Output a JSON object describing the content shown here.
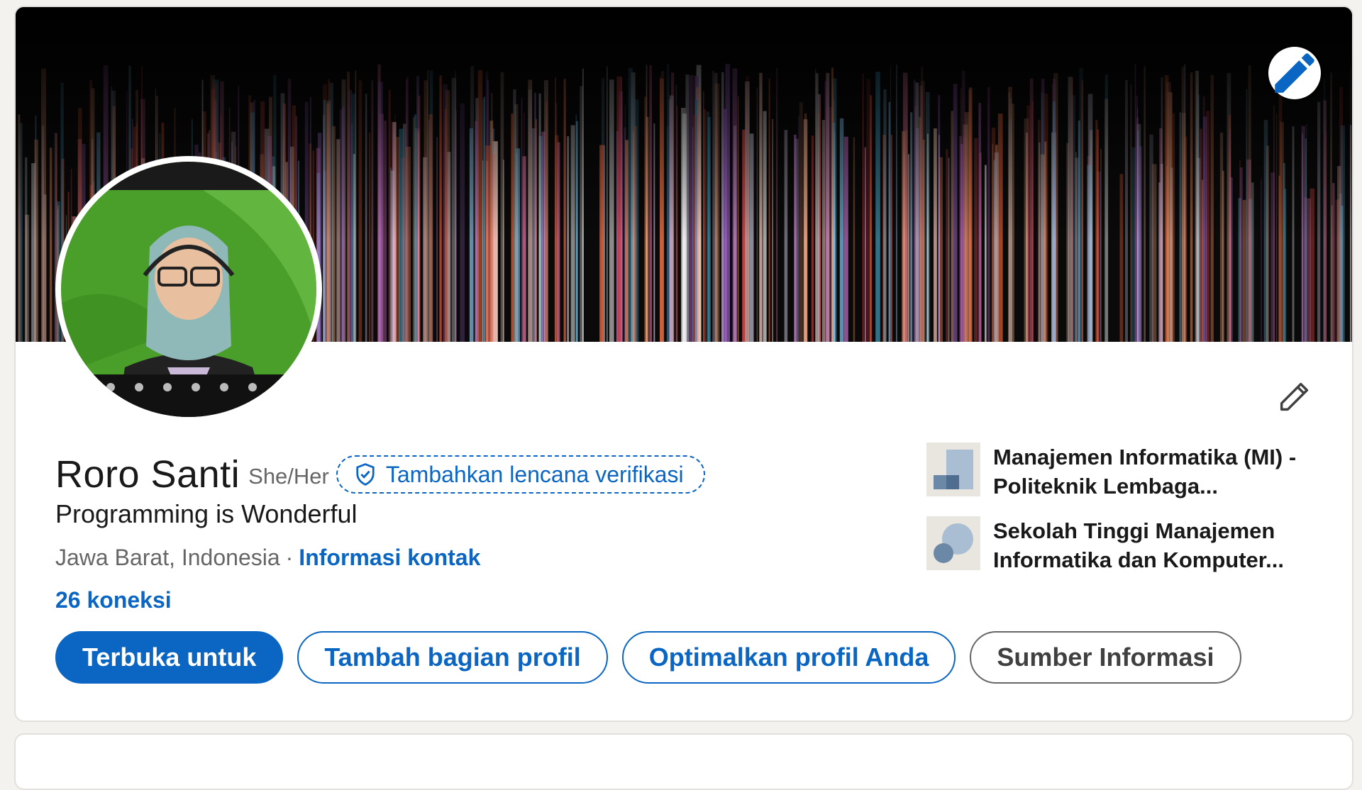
{
  "profile": {
    "name": "Roro Santi",
    "pronouns": "She/Her",
    "verify_badge_label": "Tambahkan lencana verifikasi",
    "headline": "Programming is Wonderful",
    "location": "Jawa Barat, Indonesia",
    "separator": "·",
    "contact_info_label": "Informasi kontak",
    "connections": "26 koneksi"
  },
  "actions": {
    "open_to": "Terbuka untuk",
    "add_section": "Tambah bagian profil",
    "optimize": "Optimalkan profil Anda",
    "resources": "Sumber Informasi"
  },
  "organizations": [
    {
      "name": "Manajemen Informatika (MI) - Politeknik Lembaga...",
      "logo": "education-building-icon"
    },
    {
      "name": "Sekolah Tinggi Manajemen Informatika dan Komputer...",
      "logo": "education-circles-icon"
    }
  ],
  "icons": {
    "cover_edit": "pencil-icon",
    "intro_edit": "pencil-outline-icon",
    "verify": "shield-check-icon"
  },
  "colors": {
    "brand_blue": "#0a66c2",
    "text_primary": "#191919",
    "text_secondary": "#666666",
    "page_bg": "#f4f2ee"
  }
}
